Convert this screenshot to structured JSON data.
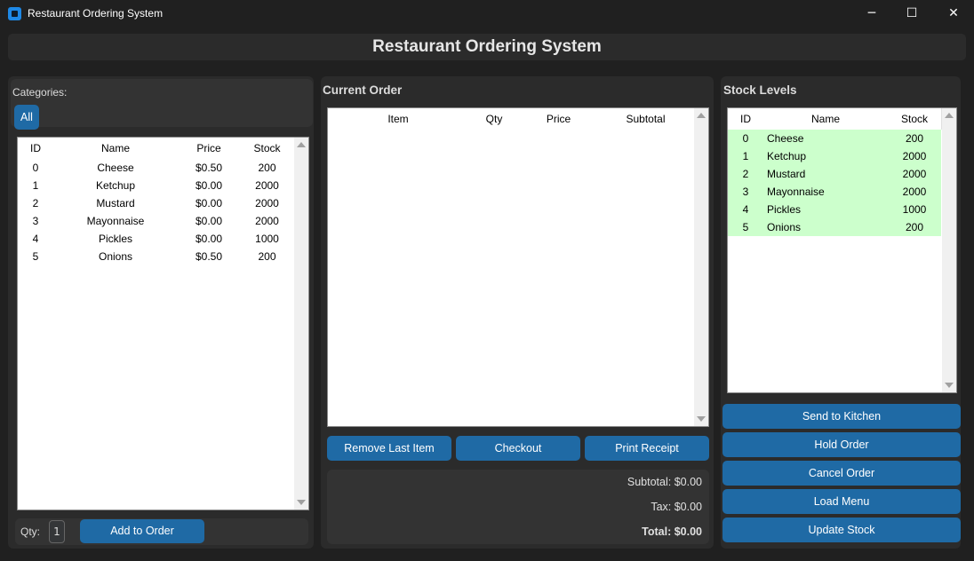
{
  "window": {
    "title": "Restaurant Ordering System",
    "minimize": "─",
    "maximize": "☐",
    "close": "✕"
  },
  "header": {
    "title": "Restaurant Ordering System"
  },
  "menu": {
    "categories_label": "Categories:",
    "category_buttons": [
      "All"
    ],
    "columns": [
      "ID",
      "Name",
      "Price",
      "Stock"
    ],
    "rows": [
      [
        "0",
        "Cheese",
        "$0.50",
        "200"
      ],
      [
        "1",
        "Ketchup",
        "$0.00",
        "2000"
      ],
      [
        "2",
        "Mustard",
        "$0.00",
        "2000"
      ],
      [
        "3",
        "Mayonnaise",
        "$0.00",
        "2000"
      ],
      [
        "4",
        "Pickles",
        "$0.00",
        "1000"
      ],
      [
        "5",
        "Onions",
        "$0.50",
        "200"
      ]
    ],
    "qty_label": "Qty:",
    "qty_value": "1",
    "add_button": "Add to Order"
  },
  "order": {
    "title": "Current Order",
    "columns": [
      "Item",
      "Qty",
      "Price",
      "Subtotal"
    ],
    "buttons": {
      "remove": "Remove Last Item",
      "checkout": "Checkout",
      "print": "Print Receipt"
    },
    "subtotal": "Subtotal: $0.00",
    "tax": "Tax: $0.00",
    "total": "Total: $0.00"
  },
  "stock": {
    "title": "Stock Levels",
    "columns": [
      "ID",
      "Name",
      "Stock"
    ],
    "rows": [
      [
        "0",
        "Cheese",
        "200"
      ],
      [
        "1",
        "Ketchup",
        "2000"
      ],
      [
        "2",
        "Mustard",
        "2000"
      ],
      [
        "3",
        "Mayonnaise",
        "2000"
      ],
      [
        "4",
        "Pickles",
        "1000"
      ],
      [
        "5",
        "Onions",
        "200"
      ]
    ],
    "ok_color": "#ccffcc"
  },
  "actions": [
    "Send to Kitchen",
    "Hold Order",
    "Cancel Order",
    "Load Menu",
    "Update Stock"
  ],
  "colors": {
    "accent": "#1f6aa5",
    "panel": "#2b2b2b",
    "background": "#202020"
  }
}
